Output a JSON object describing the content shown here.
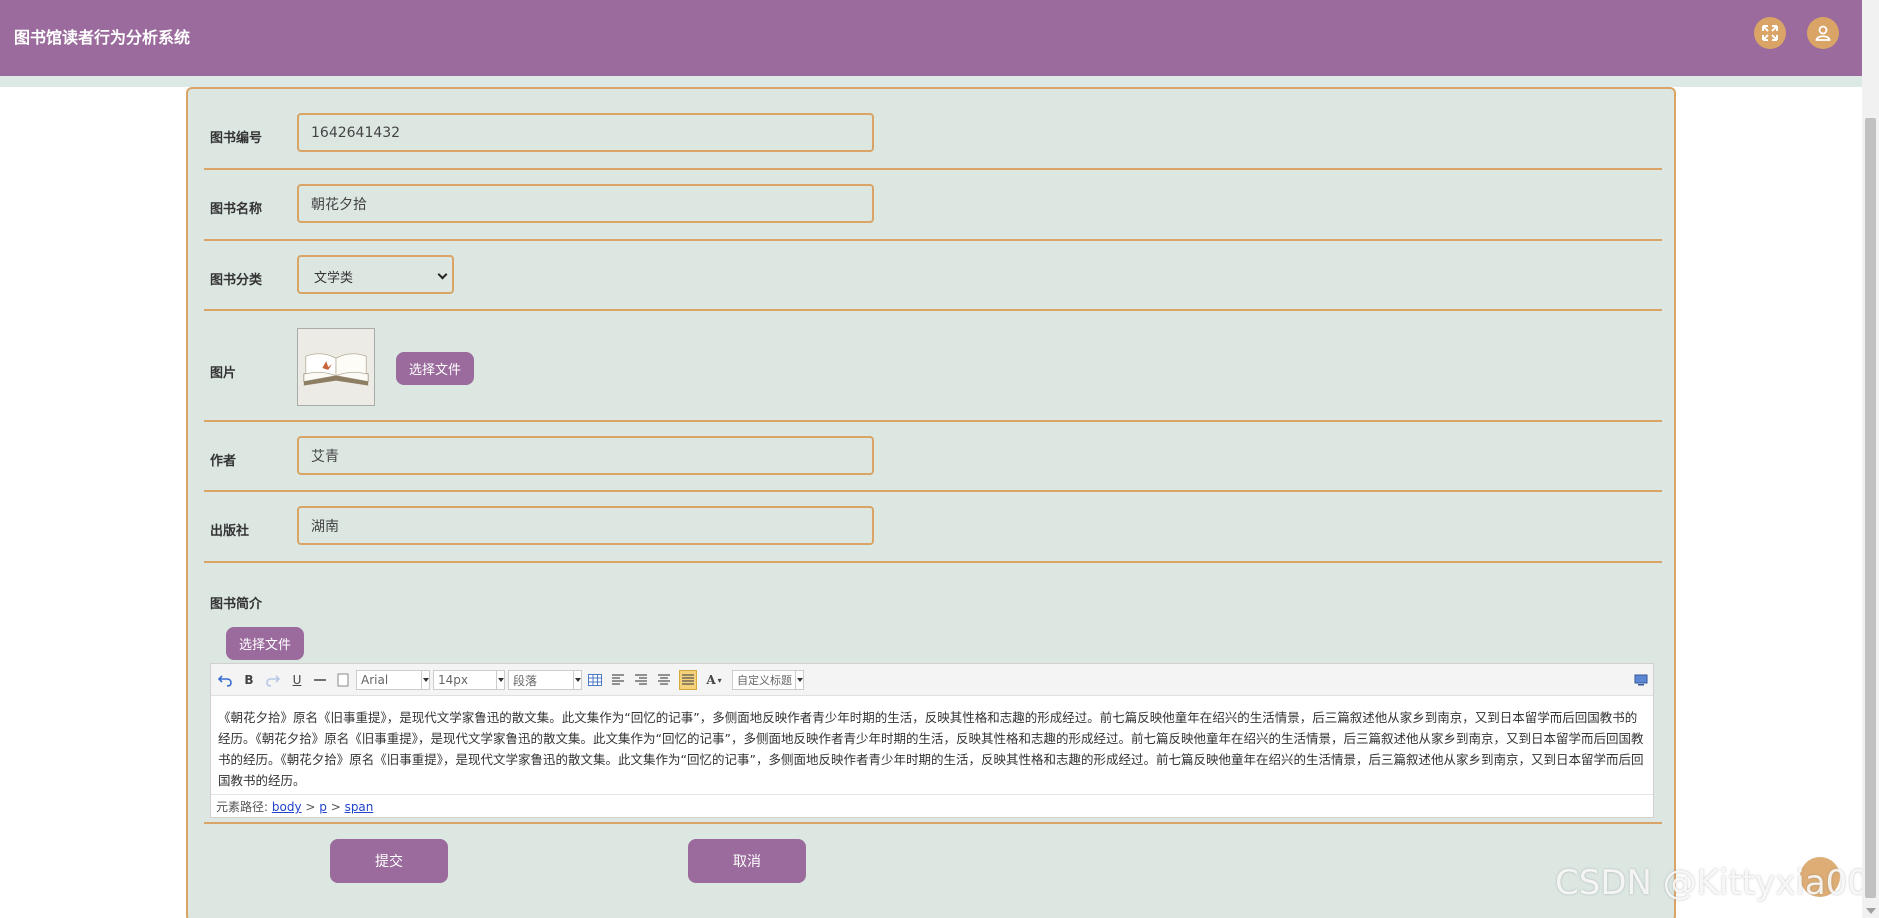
{
  "app": {
    "title": "图书馆读者行为分析系统"
  },
  "header": {
    "fullscreen_icon": "expand-arrows-icon",
    "user_icon": "user-icon"
  },
  "form": {
    "book_id": {
      "label": "图书编号",
      "value": "1642641432"
    },
    "book_name": {
      "label": "图书名称",
      "value": "朝花夕拾"
    },
    "category": {
      "label": "图书分类",
      "value": "文学类"
    },
    "image": {
      "label": "图片",
      "upload_label": "选择文件"
    },
    "author": {
      "label": "作者",
      "value": "艾青"
    },
    "publisher": {
      "label": "出版社",
      "value": "湖南"
    },
    "intro": {
      "label": "图书简介",
      "upload_label": "选择文件",
      "toolbar": {
        "font": "Arial",
        "size": "14px",
        "paragraph": "段落",
        "heading": "自定义标题"
      },
      "content": "《朝花夕拾》原名《旧事重提》，是现代文学家鲁迅的散文集。此文集作为“回忆的记事”，多侧面地反映作者青少年时期的生活，反映其性格和志趣的形成经过。前七篇反映他童年在绍兴的生活情景，后三篇叙述他从家乡到南京，又到日本留学而后回国教书的经历。《朝花夕拾》原名《旧事重提》，是现代文学家鲁迅的散文集。此文集作为“回忆的记事”，多侧面地反映作者青少年时期的生活，反映其性格和志趣的形成经过。前七篇反映他童年在绍兴的生活情景，后三篇叙述他从家乡到南京，又到日本留学而后回国教书的经历。《朝花夕拾》原名《旧事重提》，是现代文学家鲁迅的散文集。此文集作为“回忆的记事”，多侧面地反映作者青少年时期的生活，反映其性格和志趣的形成经过。前七篇反映他童年在绍兴的生活情景，后三篇叙述他从家乡到南京，又到日本留学而后回国教书的经历。",
      "path_label": "元素路径:",
      "path": [
        "body",
        "p",
        "span"
      ]
    },
    "submit_label": "提交",
    "cancel_label": "取消"
  },
  "watermark": "CSDN @Kittyxia001",
  "colors": {
    "primary": "#9a6b9c",
    "accent": "#d9a466",
    "panel": "#dce7e2"
  }
}
